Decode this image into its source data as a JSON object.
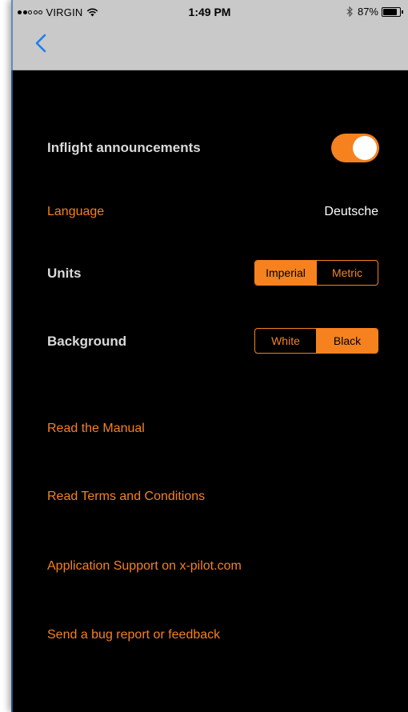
{
  "status_bar": {
    "carrier": "VIRGIN",
    "time": "1:49 PM",
    "battery": "87%",
    "battery_level": 0.87,
    "signal_dots_filled": 2,
    "signal_dots_total": 5
  },
  "nav": {
    "back_icon": "chevron-left-icon"
  },
  "settings": {
    "inflight": {
      "label": "Inflight announcements",
      "enabled": true
    },
    "language": {
      "label": "Language",
      "value": "Deutsche"
    },
    "units": {
      "label": "Units",
      "options": [
        "Imperial",
        "Metric"
      ],
      "selected": "Imperial"
    },
    "background": {
      "label": "Background",
      "options": [
        "White",
        "Black"
      ],
      "selected": "Black"
    }
  },
  "links": {
    "manual": "Read the Manual",
    "terms": "Read Terms and Conditions",
    "support": "Application Support on x-pilot.com",
    "feedback": "Send a bug report or feedback"
  },
  "colors": {
    "accent": "#f5821f",
    "background": "#000000",
    "bar": "#c9c9c9",
    "ios_blue": "#1e7cf2"
  }
}
